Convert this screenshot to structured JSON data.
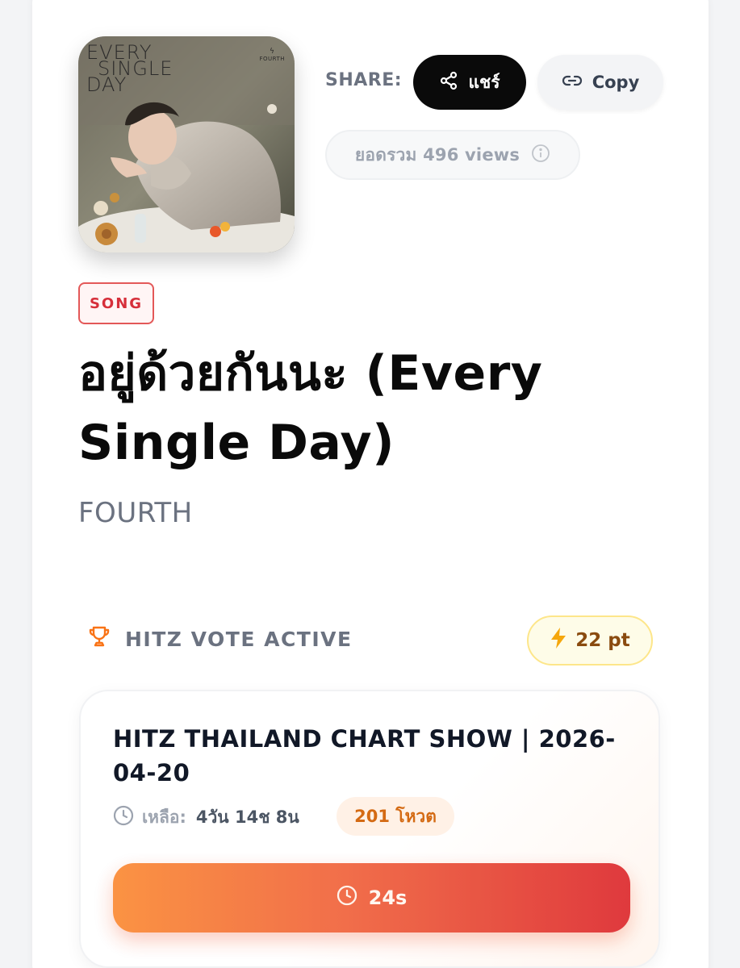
{
  "cover": {
    "title_lines": [
      "EVERY",
      "SINGLE",
      "DAY"
    ],
    "brand": "FOURTH"
  },
  "share": {
    "label": "SHARE:",
    "share_button_label": "แชร์",
    "copy_button_label": "Copy",
    "views_text": "ยอดรวม 496 views"
  },
  "song": {
    "badge": "SONG",
    "title": "อยู่ด้วยกันนะ (Every Single Day)",
    "artist": "FOURTH"
  },
  "vote": {
    "status_label": "HITZ VOTE ACTIVE",
    "points": "22 pt",
    "accent_color": "#f97316"
  },
  "chart_show": {
    "title": "HITZ THAILAND CHART SHOW | 2026-04-20",
    "remaining_label": "เหลือ:",
    "remaining_time": "4วัน 14ช 8น",
    "votes": "201 โหวต",
    "cooldown_label": "24s"
  },
  "icons": {
    "share": "share-icon",
    "copy": "link-icon",
    "info": "info-icon",
    "trophy": "trophy-icon",
    "bolt": "lightning-icon",
    "clock": "clock-icon"
  }
}
